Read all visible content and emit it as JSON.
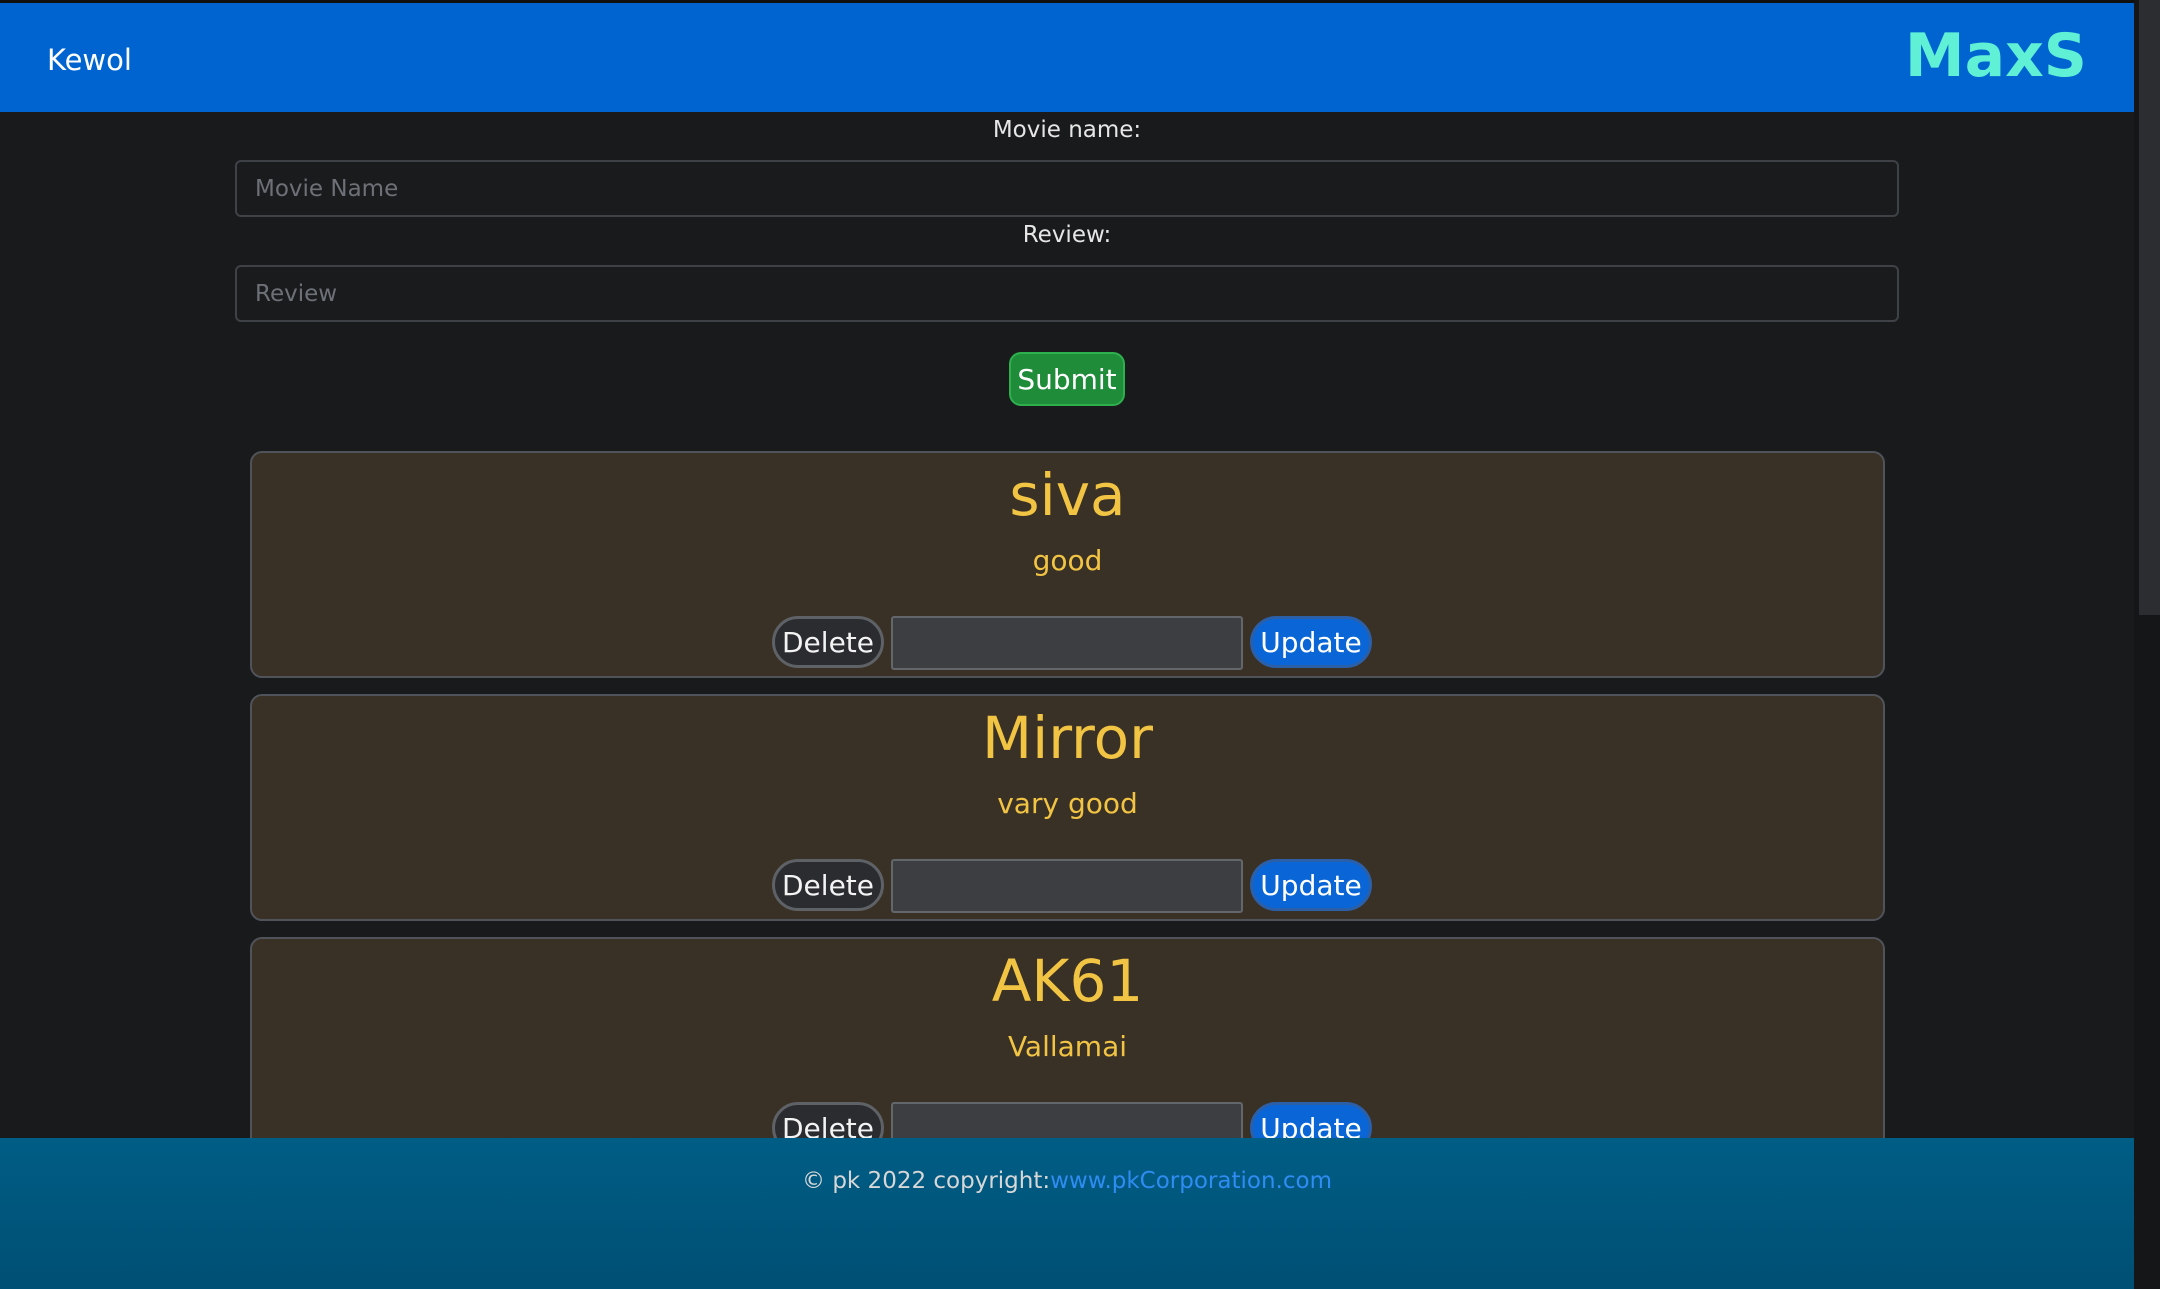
{
  "navbar": {
    "brand_left": "Kewol",
    "brand_right": "MaxS"
  },
  "form": {
    "movie_label": "Movie name:",
    "movie_placeholder": "Movie Name",
    "review_label": "Review:",
    "review_placeholder": "Review",
    "submit_label": "Submit"
  },
  "reviews": [
    {
      "title": "siva",
      "review": "good",
      "delete_label": "Delete",
      "update_label": "Update"
    },
    {
      "title": "Mirror",
      "review": "vary good",
      "delete_label": "Delete",
      "update_label": "Update"
    },
    {
      "title": "AK61",
      "review": "Vallamai",
      "delete_label": "Delete",
      "update_label": "Update"
    }
  ],
  "footer": {
    "text": "© pk 2022 copyright:",
    "link": "www.pkCorporation.com"
  },
  "colors": {
    "navbar": "#0064d0",
    "brand_right": "#5ff0d6",
    "card_bg": "#3a3126",
    "card_text": "#f2c444",
    "submit": "#1f8c3a",
    "update": "#0a66d6",
    "footer": "#005d85"
  }
}
